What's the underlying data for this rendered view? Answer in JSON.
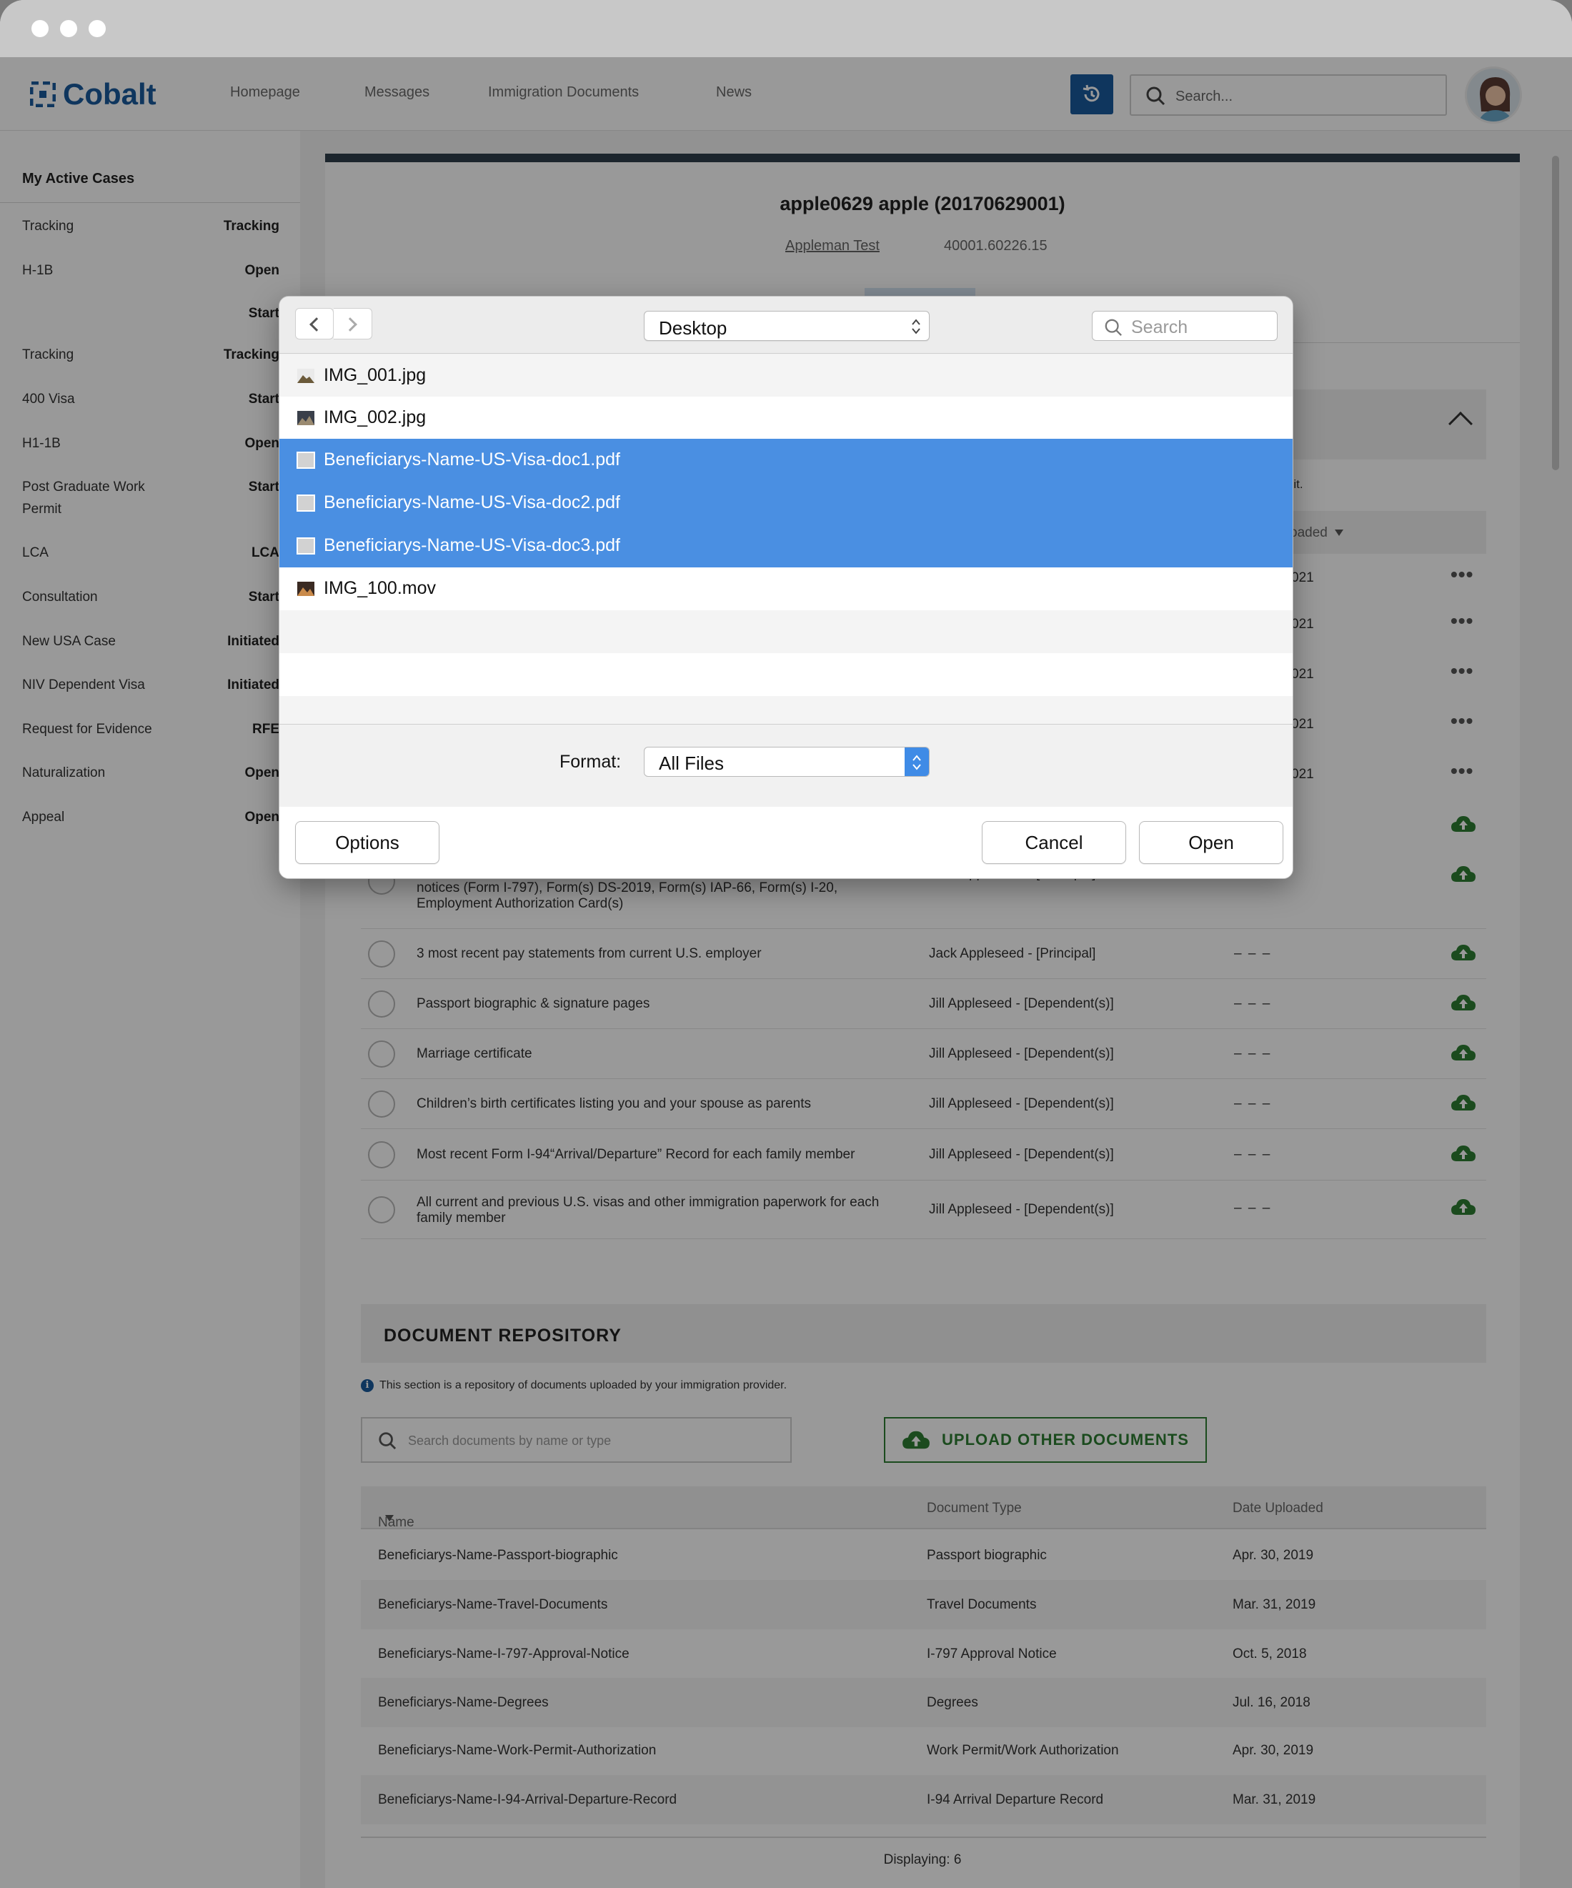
{
  "app": {
    "brand": "Cobalt",
    "brand_color": "#1a5b9d",
    "nav": [
      "Homepage",
      "Messages",
      "Immigration Documents",
      "News"
    ],
    "search_placeholder": "Search..."
  },
  "sidebar": {
    "heading": "My Active Cases",
    "items": [
      {
        "label": "Tracking",
        "status": "Tracking"
      },
      {
        "label": "H-1B",
        "status": "Open"
      },
      {
        "label": "",
        "status": "Start"
      },
      {
        "label": "Tracking",
        "status": "Tracking"
      },
      {
        "label": "400 Visa",
        "status": "Start"
      },
      {
        "label": "H1-1B",
        "status": "Open"
      },
      {
        "label": "Post Graduate Work Permit",
        "status": "Start"
      },
      {
        "label": "LCA",
        "status": "LCA"
      },
      {
        "label": "Consultation",
        "status": "Start"
      },
      {
        "label": "New USA Case",
        "status": "Initiated"
      },
      {
        "label": "NIV Dependent Visa",
        "status": "Initiated"
      },
      {
        "label": "Request for Evidence",
        "status": "RFE"
      },
      {
        "label": "Naturalization",
        "status": "Open"
      },
      {
        "label": "Appeal",
        "status": "Open"
      }
    ]
  },
  "case": {
    "title": "apple0629 apple (20170629001)",
    "link": "Appleman Test",
    "number": "40001.60226.15",
    "note_tail": "r it.",
    "col_tail": "oaded",
    "year_tail": [
      "021",
      "021",
      "021",
      "021",
      "021"
    ],
    "more_icon": "•••"
  },
  "requests": [
    {
      "desc": "All current and previous U.S. immigration paperwork, including: Prior approval notices (Form I-797), Form(s) DS-2019, Form(s) IAP-66, Form(s) I-20, Employment Authorization Card(s)",
      "who": "Jack Appleseed - [Principal]",
      "date": "– – –"
    },
    {
      "desc": "3 most recent pay statements from current U.S. employer",
      "who": "Jack Appleseed - [Principal]",
      "date": "– – –"
    },
    {
      "desc": "Passport biographic & signature pages",
      "who": "Jill Appleseed - [Dependent(s)]",
      "date": "– – –"
    },
    {
      "desc": "Marriage certificate",
      "who": "Jill Appleseed - [Dependent(s)]",
      "date": "– – –"
    },
    {
      "desc": "Children’s birth certificates listing you and your spouse as parents",
      "who": "Jill Appleseed - [Dependent(s)]",
      "date": "– – –"
    },
    {
      "desc": "Most recent Form I-94“Arrival/Departure” Record for each family member",
      "who": "Jill Appleseed - [Dependent(s)]",
      "date": "– – –"
    },
    {
      "desc": "All current and previous U.S. visas and other immigration paperwork for each family member",
      "who": "Jill Appleseed - [Dependent(s)]",
      "date": "– – –"
    }
  ],
  "repository": {
    "title": "DOCUMENT REPOSITORY",
    "info": "This section is a repository of documents uploaded by your immigration provider.",
    "search_placeholder": "Search documents by name or type",
    "upload_label": "UPLOAD OTHER DOCUMENTS",
    "columns": [
      "Name",
      "Document Type",
      "Date Uploaded"
    ],
    "rows": [
      {
        "name": "Beneficiarys-Name-Passport-biographic",
        "type": "Passport biographic",
        "date": "Apr. 30, 2019"
      },
      {
        "name": "Beneficiarys-Name-Travel-Documents",
        "type": "Travel Documents",
        "date": "Mar. 31, 2019"
      },
      {
        "name": "Beneficiarys-Name-I-797-Approval-Notice",
        "type": "I-797 Approval Notice",
        "date": "Oct. 5, 2018"
      },
      {
        "name": "Beneficiarys-Name-Degrees",
        "type": "Degrees",
        "date": "Jul. 16, 2018"
      },
      {
        "name": "Beneficiarys-Name-Work-Permit-Authorization",
        "type": "Work Permit/Work Authorization",
        "date": "Apr. 30, 2019"
      },
      {
        "name": "Beneficiarys-Name-I-94-Arrival-Departure-Record",
        "type": "I-94 Arrival Departure Record",
        "date": "Mar. 31, 2019"
      }
    ],
    "displaying": "Displaying: 6"
  },
  "dialog": {
    "location": "Desktop",
    "search_placeholder": "Search",
    "files": [
      {
        "name": "IMG_001.jpg",
        "icon": "image-icon",
        "selected": false
      },
      {
        "name": "IMG_002.jpg",
        "icon": "image-icon",
        "selected": false
      },
      {
        "name": "Beneficiarys-Name-US-Visa-doc1.pdf",
        "icon": "pdf-icon",
        "selected": true
      },
      {
        "name": "Beneficiarys-Name-US-Visa-doc2.pdf",
        "icon": "pdf-icon",
        "selected": true
      },
      {
        "name": "Beneficiarys-Name-US-Visa-doc3.pdf",
        "icon": "pdf-icon",
        "selected": true
      },
      {
        "name": "IMG_100.mov",
        "icon": "video-icon",
        "selected": false
      }
    ],
    "format_label": "Format:",
    "format_value": "All Files",
    "options_label": "Options",
    "cancel_label": "Cancel",
    "open_label": "Open",
    "selection_color": "#4a8fe2"
  }
}
